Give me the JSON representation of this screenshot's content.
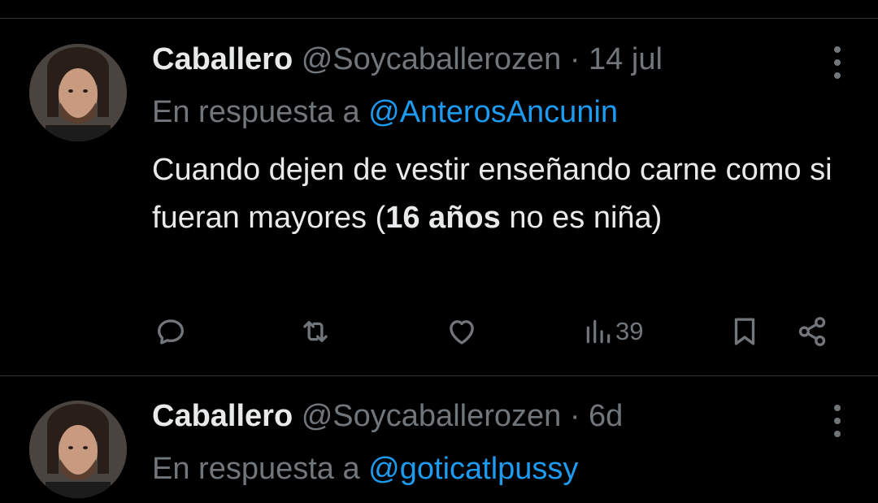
{
  "tweets": [
    {
      "author_name": "Caballero",
      "handle": "@Soycaballerozen",
      "separator": "·",
      "time": "14 jul",
      "reply_prefix": "En respuesta a",
      "reply_to": "@AnterosAncunin",
      "text_part1": "Cuando dejen de vestir enseñando carne como si fueran mayores (",
      "text_bold": "16 años",
      "text_part2": " no es niña)",
      "views": "39"
    },
    {
      "author_name": "Caballero",
      "handle": "@Soycaballerozen",
      "separator": "·",
      "time": "6d",
      "reply_prefix": "En respuesta a",
      "reply_to": "@goticatlpussy"
    }
  ],
  "icons": [
    "more-vertical-icon",
    "reply-icon",
    "retweet-icon",
    "like-icon",
    "views-icon",
    "bookmark-icon",
    "share-icon"
  ],
  "colors": {
    "background": "#000000",
    "text": "#e7e9ea",
    "muted": "#71767b",
    "accent": "#1d9bf0",
    "divider": "#2f3336"
  }
}
